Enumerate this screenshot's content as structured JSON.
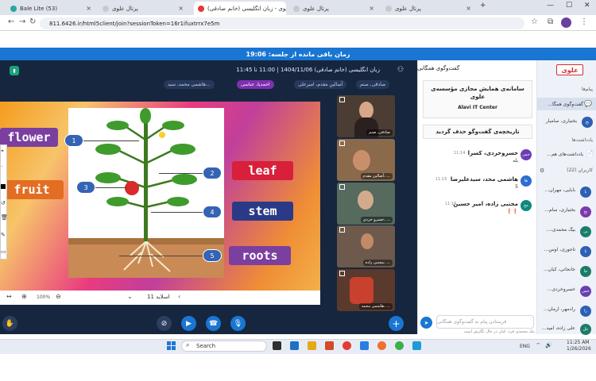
{
  "browser": {
    "tabs": [
      {
        "title": "Bale Lite (53)",
        "color": "#2aa7a0"
      },
      {
        "title": "پرتال علوی",
        "color": "#e0e0e0"
      },
      {
        "title": "علوی - زبان انگلیسی (خانم صادقی)",
        "color": "#e53935"
      },
      {
        "title": "پرتال علوی",
        "color": "#e0e0e0"
      },
      {
        "title": "پرتال علوی",
        "color": "#e0e0e0"
      }
    ],
    "new_tab": "+",
    "url": "811.6426.ir/html5client/join?sessionToken=16r1ifuxtrrx7e5m"
  },
  "timer": {
    "text": "زمان باقی مانده از جلسه: 19:06"
  },
  "topbar": {
    "meeting_title": "زبان انگلیسی (خانم صادقی) 1404/11/06 | 11:00 تا 11:45",
    "pills": [
      "صادقی, صنم",
      "آصالین مقدم، امیرعلی",
      "احمدیا، عباسی",
      "هاشمی محمد، سید..."
    ]
  },
  "slide": {
    "labels": [
      "flower",
      "fruit",
      "leaf",
      "stem",
      "roots"
    ],
    "numbers": [
      "1",
      "2",
      "3",
      "4",
      "5"
    ],
    "page_label": "اسلاید 11",
    "zoom": "100%"
  },
  "videos": [
    {
      "name": "صادقی, صنم"
    },
    {
      "name": "آصالین مقدم، ..."
    },
    {
      "name": "خسرو خردی، ..."
    },
    {
      "name": "مجتبی زاده، ..."
    },
    {
      "name": "هاشمی محمد، ..."
    }
  ],
  "chat": {
    "title": "گفت‌وگوی همگانی",
    "welcome_line1": "سامانه‌ی همایش مجازی مؤسسه‌ی علوی",
    "welcome_line2": "Alavi IT Center",
    "cleared": "تاریخچه‌ی گفت‌وگو حذف گردید",
    "messages": [
      {
        "initials": "خس",
        "name": "خسروخردی، کسرا",
        "time": "11:14",
        "text": "بله",
        "color": "#6a3fb3"
      },
      {
        "initials": "ها",
        "name": "هاشمی محد، سیدعلیرضا",
        "time": "11:15",
        "text": "5",
        "color": "#2d6ecf"
      },
      {
        "initials": "مج",
        "name": "مجتبی زاده، امیر حسین",
        "time": "11:16",
        "text": "❗❗",
        "color": "#0e8a7f"
      }
    ],
    "input_placeholder": "فرستادن پیام به گفت‌وگوی همگانی",
    "typing": "نیک محمدی فرد، کیان در حال نگارش است"
  },
  "sidebar": {
    "logo": "علوی",
    "messages_heading": "پیام‌ها",
    "public_chat": "گفت‌وگوی همگا...",
    "private_chat": "بختیاری، سامیار",
    "notes_heading": "یادداشت‌ها",
    "shared_notes": "یادداشت‌های هم...",
    "users_heading": "کاربران (22)",
    "users": [
      {
        "name": "بابایی، مهران...",
        "initials": "با",
        "color": "#2e5fb5"
      },
      {
        "name": "بختیاری، سام...",
        "initials": "بخ",
        "color": "#7c3aab"
      },
      {
        "name": "بیگ محمدی،...",
        "initials": "بی",
        "color": "#1c7c6a"
      },
      {
        "name": "تاجوری، اوس...",
        "initials": "تا",
        "color": "#2e5fb5"
      },
      {
        "name": "جانجانی، کیان...",
        "initials": "جا",
        "color": "#1c7c6a"
      },
      {
        "name": "خسروخردی...",
        "initials": "خس",
        "color": "#6a3fb3"
      },
      {
        "name": "رادمهر، آرمان...",
        "initials": "را",
        "color": "#2e5fb5"
      },
      {
        "name": "علی زاده، امید...",
        "initials": "عل",
        "color": "#1c7c6a"
      }
    ]
  },
  "taskbar": {
    "search": "Search",
    "lang": "ENG",
    "time": "11:25 AM",
    "date": "1/26/2026"
  }
}
